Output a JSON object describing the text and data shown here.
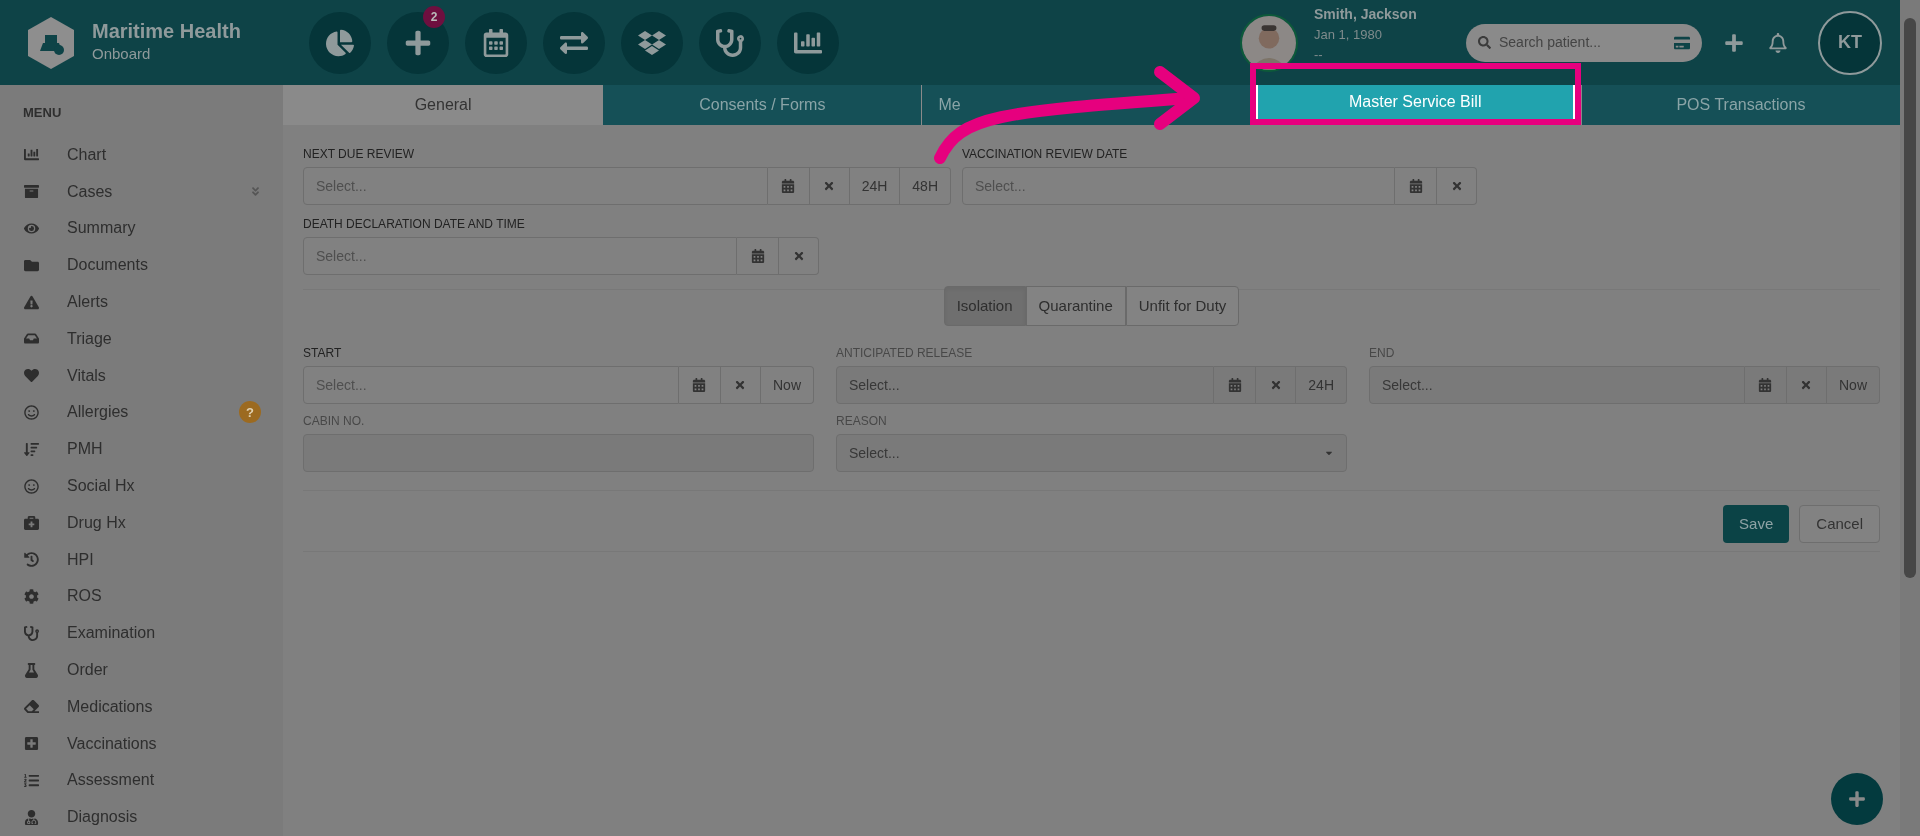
{
  "app": {
    "name": "Maritime Health",
    "subtitle": "Onboard"
  },
  "toolbar": {
    "badge": "2"
  },
  "patient": {
    "name": "Smith, Jackson",
    "dob": "Jan 1, 1980",
    "line_3": "--"
  },
  "search": {
    "placeholder": "Search patient..."
  },
  "user": {
    "initials": "KT"
  },
  "sidebar": {
    "title": "MENU",
    "items": [
      {
        "label": "Chart"
      },
      {
        "label": "Cases",
        "expandable": true
      },
      {
        "label": "Summary"
      },
      {
        "label": "Documents"
      },
      {
        "label": "Alerts"
      },
      {
        "label": "Triage"
      },
      {
        "label": "Vitals"
      },
      {
        "label": "Allergies",
        "badge": "?"
      },
      {
        "label": "PMH"
      },
      {
        "label": "Social Hx"
      },
      {
        "label": "Drug Hx"
      },
      {
        "label": "HPI"
      },
      {
        "label": "ROS"
      },
      {
        "label": "Examination"
      },
      {
        "label": "Order"
      },
      {
        "label": "Medications"
      },
      {
        "label": "Vaccinations"
      },
      {
        "label": "Assessment"
      },
      {
        "label": "Diagnosis"
      }
    ]
  },
  "tabs": [
    {
      "label": "General",
      "selected": true,
      "highlighted": false
    },
    {
      "label": "Consents / Forms",
      "selected": false,
      "highlighted": false
    },
    {
      "label": "Me",
      "selected": false,
      "highlighted": false,
      "clipped": true
    },
    {
      "label": "Master Service Bill",
      "selected": false,
      "highlighted": true
    },
    {
      "label": "POS Transactions",
      "selected": false,
      "highlighted": false
    }
  ],
  "review_fields": [
    {
      "kind": "date",
      "label": "NEXT DUE REVIEW",
      "placeholder": "Select...",
      "addons": [
        "24H",
        "48H"
      ],
      "disabled": false
    },
    {
      "kind": "date",
      "label": "VACCINATION REVIEW DATE",
      "placeholder": "Select...",
      "disabled": false
    },
    {
      "kind": "date",
      "label": "DEATH DECLARATION DATE AND TIME",
      "placeholder": "Select...",
      "disabled": false
    }
  ],
  "status_options": [
    {
      "label": "Isolation",
      "selected": true
    },
    {
      "label": "Quarantine",
      "selected": false
    },
    {
      "label": "Unfit for Duty",
      "selected": false
    }
  ],
  "isolation_fields": [
    {
      "kind": "date",
      "label": "START",
      "placeholder": "Select...",
      "addons": [
        "Now"
      ],
      "disabled": false
    },
    {
      "kind": "date",
      "label": "ANTICIPATED RELEASE",
      "placeholder": "Select...",
      "addons": [
        "24H"
      ],
      "disabled": true
    },
    {
      "kind": "date",
      "label": "END",
      "placeholder": "Select...",
      "addons": [
        "Now"
      ],
      "disabled": true
    },
    {
      "kind": "text",
      "label": "CABIN NO.",
      "disabled": true
    },
    {
      "kind": "select",
      "label": "REASON",
      "placeholder": "Select...",
      "disabled": true
    }
  ],
  "buttons": {
    "save": "Save",
    "cancel": "Cancel"
  }
}
